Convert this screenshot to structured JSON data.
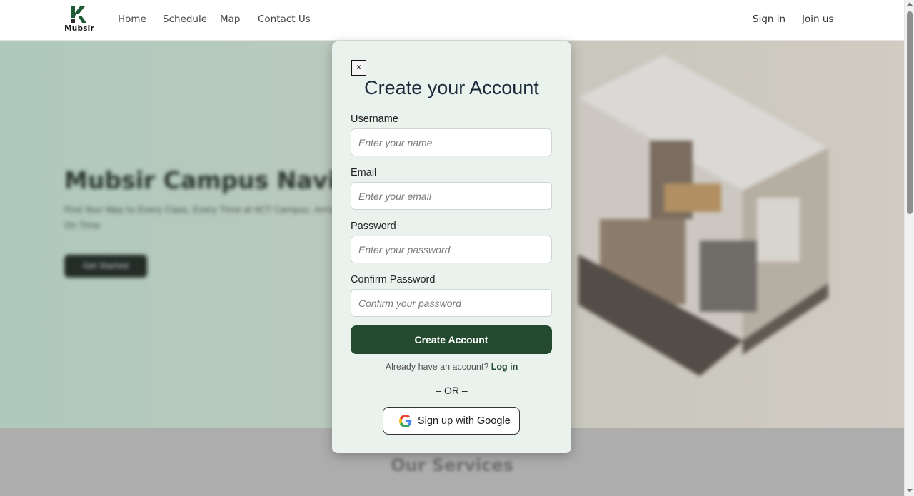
{
  "navbar": {
    "logo_text": "Mubsir",
    "links": {
      "home": "Home",
      "schedule": "Schedule",
      "map": "Map",
      "contact": "Contact Us"
    },
    "sign_in": "Sign in",
    "join_us": "Join us"
  },
  "hero": {
    "title": "Mubsir Campus Navigator",
    "subtitle": "Find Your Way to Every Class, Every Time at KCT Campus. Arrive On Time",
    "button": "Get Started"
  },
  "services": {
    "title": "Our Services"
  },
  "modal": {
    "close": "×",
    "title": "Create your Account",
    "username": {
      "label": "Username",
      "placeholder": "Enter your name",
      "value": ""
    },
    "email": {
      "label": "Email",
      "placeholder": "Enter your email",
      "value": ""
    },
    "password": {
      "label": "Password",
      "placeholder": "Enter your password",
      "value": ""
    },
    "confirm_password": {
      "label": "Confirm Password",
      "placeholder": "Confirm your password",
      "value": ""
    },
    "create_button": "Create Account",
    "have_account": "Already have an account?",
    "login_link": "Log in",
    "or": "– OR –",
    "google_button": "Sign up with Google",
    "google_icon": "google-icon"
  },
  "colors": {
    "primary": "#234a2f",
    "modal_bg": "#eaf2ee",
    "title": "#1b2b3a"
  }
}
